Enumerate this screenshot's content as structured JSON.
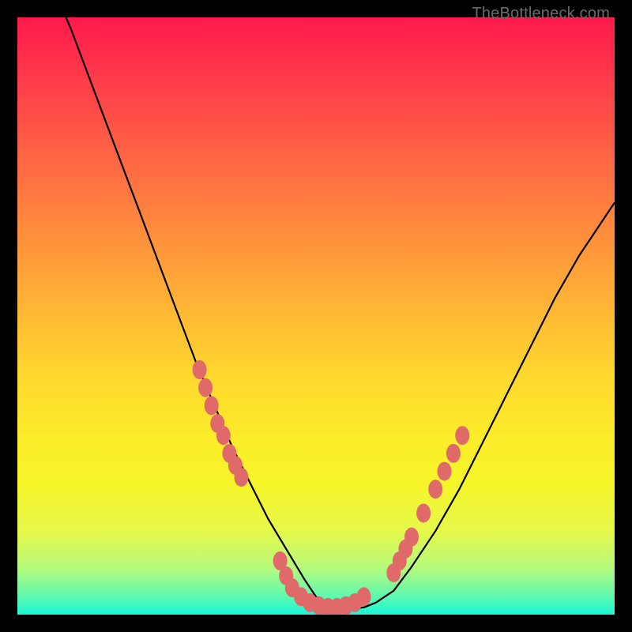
{
  "watermark": "TheBottleneck.com",
  "colors": {
    "curve": "#000000",
    "marker": "#e06a6a",
    "frame_bg_top": "#ff1a4d",
    "frame_bg_bottom": "#18f7d6",
    "page_bg": "#000000"
  },
  "chart_data": {
    "type": "line",
    "title": "",
    "xlabel": "",
    "ylabel": "",
    "xlim": [
      0,
      100
    ],
    "ylim": [
      0,
      100
    ],
    "series": [
      {
        "name": "bottleneck-curve",
        "x": [
          0,
          3,
          6,
          9,
          12,
          15,
          18,
          21,
          24,
          27,
          30,
          33,
          36,
          39,
          42,
          45,
          48,
          50,
          52,
          54,
          56,
          58,
          60,
          63,
          66,
          70,
          74,
          78,
          82,
          86,
          90,
          94,
          98,
          100
        ],
        "y": [
          118,
          112,
          105,
          98,
          90,
          82,
          74,
          66,
          58,
          50,
          42,
          35,
          28,
          22,
          16,
          11,
          6,
          3,
          1.5,
          1,
          1,
          1.2,
          2,
          4,
          8,
          14,
          21,
          29,
          37,
          45,
          53,
          60,
          66,
          69
        ]
      }
    ],
    "markers": {
      "name": "highlight-dots",
      "points": [
        {
          "x": 30.5,
          "y": 41
        },
        {
          "x": 31.5,
          "y": 38
        },
        {
          "x": 32.5,
          "y": 35
        },
        {
          "x": 33.5,
          "y": 32
        },
        {
          "x": 34.5,
          "y": 30
        },
        {
          "x": 35.5,
          "y": 27
        },
        {
          "x": 36.5,
          "y": 25
        },
        {
          "x": 37.5,
          "y": 23
        },
        {
          "x": 44.0,
          "y": 9
        },
        {
          "x": 45.0,
          "y": 6.5
        },
        {
          "x": 46.0,
          "y": 4.5
        },
        {
          "x": 47.5,
          "y": 3
        },
        {
          "x": 49.0,
          "y": 2
        },
        {
          "x": 50.5,
          "y": 1.5
        },
        {
          "x": 52.0,
          "y": 1.2
        },
        {
          "x": 53.5,
          "y": 1.2
        },
        {
          "x": 55.0,
          "y": 1.5
        },
        {
          "x": 56.5,
          "y": 2.0
        },
        {
          "x": 58.0,
          "y": 3.0
        },
        {
          "x": 63.0,
          "y": 7
        },
        {
          "x": 64.0,
          "y": 9
        },
        {
          "x": 65.0,
          "y": 11
        },
        {
          "x": 66.0,
          "y": 13
        },
        {
          "x": 68.0,
          "y": 17
        },
        {
          "x": 70.0,
          "y": 21
        },
        {
          "x": 71.5,
          "y": 24
        },
        {
          "x": 73.0,
          "y": 27
        },
        {
          "x": 74.5,
          "y": 30
        }
      ]
    }
  }
}
